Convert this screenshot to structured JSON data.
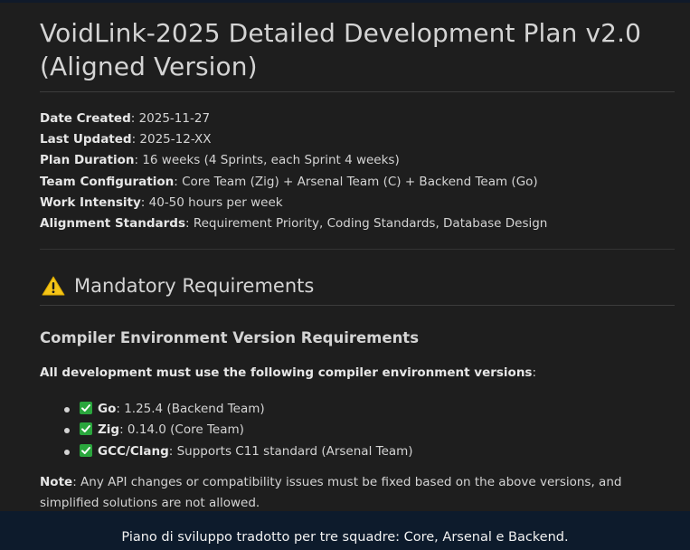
{
  "document": {
    "title_line1": "VoidLink-2025 Detailed Development Plan v2.0",
    "title_line2": "(Aligned Version)",
    "metadata": [
      {
        "label": "Date Created",
        "value": ": 2025-11-27"
      },
      {
        "label": "Last Updated",
        "value": ": 2025-12-XX"
      },
      {
        "label": "Plan Duration",
        "value": ": 16 weeks (4 Sprints, each Sprint 4 weeks)"
      },
      {
        "label": "Team Configuration",
        "value": ": Core Team (Zig) + Arsenal Team (C) + Backend Team (Go)"
      },
      {
        "label": "Work Intensity",
        "value": ": 40-50 hours per week"
      },
      {
        "label": "Alignment Standards",
        "value": ": Requirement Priority, Coding Standards, Database Design"
      }
    ],
    "section_heading": "Mandatory Requirements",
    "subsection_heading": "Compiler Environment Version Requirements",
    "intro_bold": "All development must use the following compiler environment versions",
    "intro_tail": ":",
    "requirements": [
      {
        "name": "Go",
        "detail": ": 1.25.4 (Backend Team)"
      },
      {
        "name": "Zig",
        "detail": ": 0.14.0 (Core Team)"
      },
      {
        "name": "GCC/Clang",
        "detail": ": Supports C11 standard (Arsenal Team)"
      }
    ],
    "note_label": "Note",
    "note_text": ": Any API changes or compatibility issues must be fixed based on the above versions, and simplified solutions are not allowed."
  },
  "caption": "Piano di sviluppo tradotto per tre squadre: Core, Arsenal e Backend.",
  "colors": {
    "background": "#1e1e1e",
    "text": "#d4d4d4",
    "check_green": "#2aa63d",
    "warning_yellow": "#f5c518",
    "caption_bg": "#0d1b2c"
  },
  "icons": {
    "section": "warning-icon",
    "list_item": "check-mark-icon"
  }
}
